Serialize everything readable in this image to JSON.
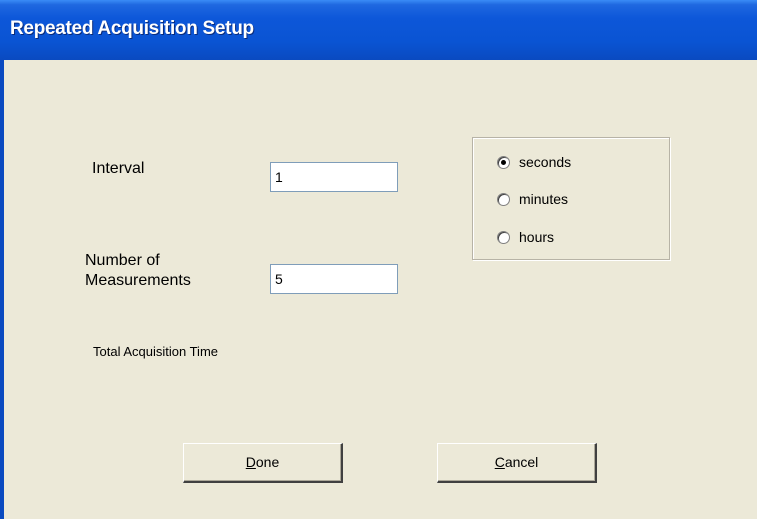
{
  "window": {
    "title": "Repeated Acquisition Setup"
  },
  "form": {
    "interval_label": "Interval",
    "interval_value": "1",
    "number_label_line1": "Number of",
    "number_label_line2": "Measurements",
    "number_value": "5",
    "total_label": "Total Acquisition Time"
  },
  "units": {
    "options": [
      {
        "label": "seconds",
        "selected": true
      },
      {
        "label": "minutes",
        "selected": false
      },
      {
        "label": "hours",
        "selected": false
      }
    ]
  },
  "buttons": {
    "done_mnemonic": "D",
    "done_rest": "one",
    "cancel_mnemonic": "C",
    "cancel_rest": "ancel"
  },
  "colors": {
    "titlebar": "#0a54d3",
    "window_bg": "#ece9d8",
    "title_text": "#ffffff"
  }
}
